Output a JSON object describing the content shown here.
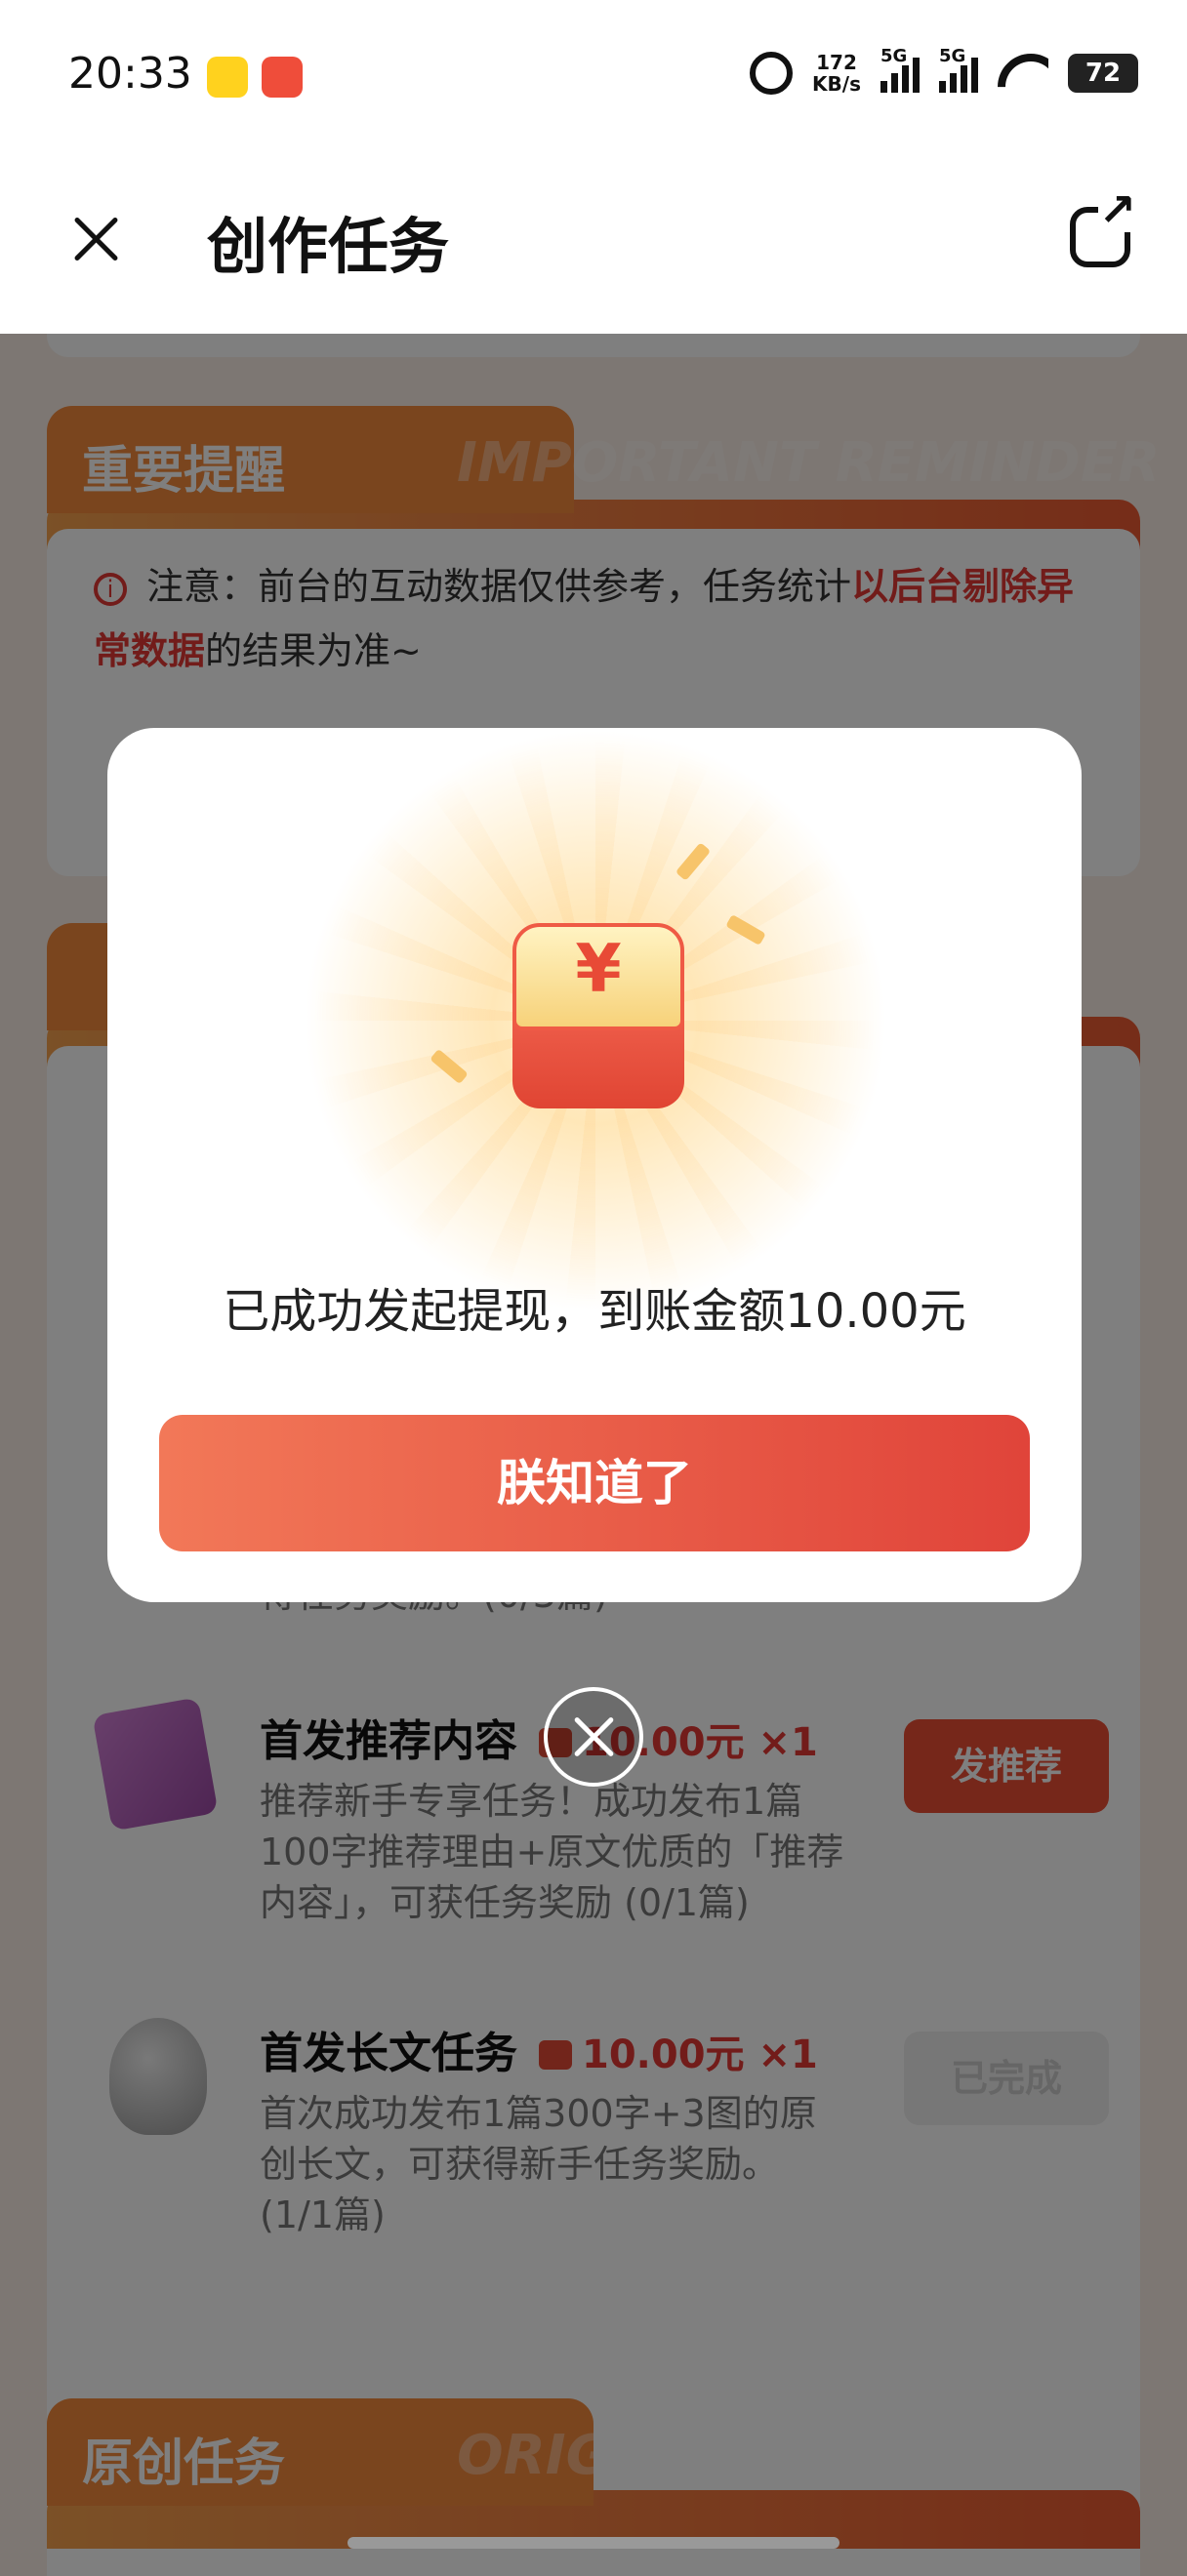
{
  "status_bar": {
    "time": "20:33",
    "net_speed_value": "172",
    "net_speed_unit": "KB/s",
    "signal1_label": "5G",
    "signal2_label": "5G",
    "battery": "72"
  },
  "header": {
    "title": "创作任务"
  },
  "reminder": {
    "tab_title": "重要提醒",
    "tab_ghost": "IMPORTANT REMINDER",
    "line1_prefix": "注意：前台的互动数据仅供参考，任务统计",
    "line1_highlight": "以后台剔除异常数据",
    "line1_suffix": "的结果为准~"
  },
  "tasks": [
    {
      "title": "首发推荐内容",
      "reward": "10.00元",
      "multiplier": "×1",
      "desc": "推荐新手专享任务！成功发布1篇100字推荐理由+原文优质的「推荐内容」，可获任务奖励 (0/1篇)",
      "button": "发推荐"
    },
    {
      "title": "首发长文任务",
      "reward": "10.00元",
      "multiplier": "×1",
      "desc": "首次成功发布1篇300字+3图的原创长文，可获得新手任务奖励。(1/1篇)",
      "button": "已完成"
    }
  ],
  "partial_task_desc": "得任务奖励。(0/3篇)",
  "original_section": {
    "tab_title": "原创任务",
    "tab_ghost": "ORIGINAL TASKS"
  },
  "modal": {
    "message": "已成功发起提现，到账金额10.00元",
    "button": "朕知道了",
    "currency_symbol": "¥"
  }
}
